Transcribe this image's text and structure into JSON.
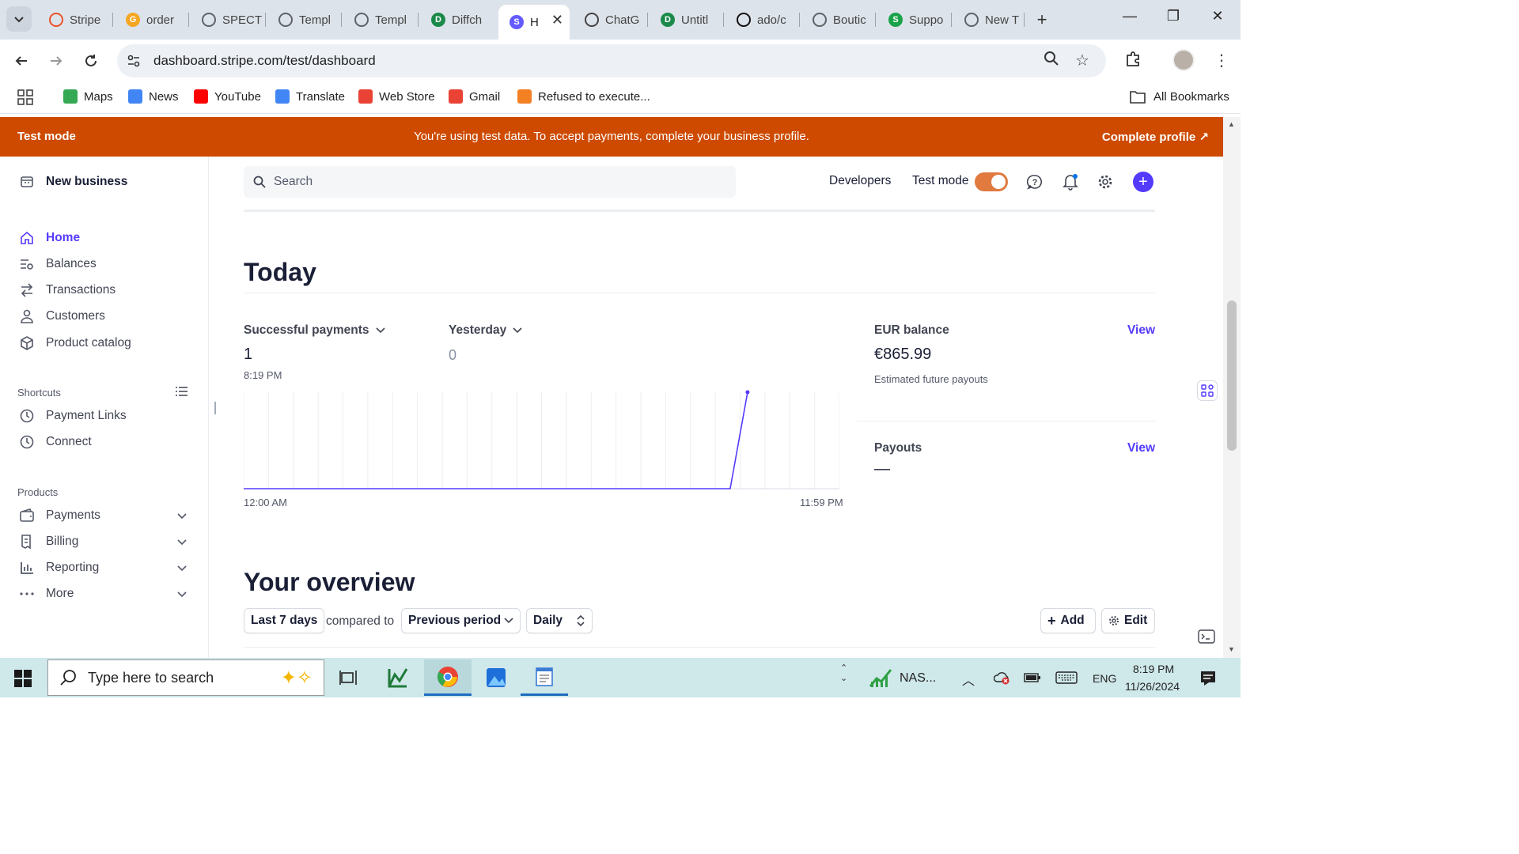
{
  "browser": {
    "tabs": [
      {
        "label": "Stripe",
        "color": "#e8532b",
        "letter": ""
      },
      {
        "label": "order",
        "color": "#f5a623",
        "letter": "G"
      },
      {
        "label": "SPECT",
        "color": "#5f6368",
        "letter": ""
      },
      {
        "label": "Templ",
        "color": "#5f6368",
        "letter": ""
      },
      {
        "label": "Templ",
        "color": "#5f6368",
        "letter": ""
      },
      {
        "label": "Diffch",
        "color": "#1a8a4a",
        "letter": "D"
      },
      {
        "label": "H",
        "color": "#635bff",
        "letter": "S"
      },
      {
        "label": "ChatG",
        "color": "#444444",
        "letter": ""
      },
      {
        "label": "Untitl",
        "color": "#1a8a4a",
        "letter": "D"
      },
      {
        "label": "ado/c",
        "color": "#111111",
        "letter": ""
      },
      {
        "label": "Boutic",
        "color": "#5f6368",
        "letter": ""
      },
      {
        "label": "Suppo",
        "color": "#1aa34a",
        "letter": "S"
      },
      {
        "label": "New T",
        "color": "#5f6368",
        "letter": ""
      }
    ],
    "url": "dashboard.stripe.com/test/dashboard",
    "bookmarks": [
      {
        "label": "Maps",
        "icon": "maps-pin-icon",
        "color": "#34a853"
      },
      {
        "label": "News",
        "icon": "news-icon",
        "color": "#4285f4"
      },
      {
        "label": "YouTube",
        "icon": "youtube-icon",
        "color": "#ff0000"
      },
      {
        "label": "Translate",
        "icon": "translate-icon",
        "color": "#4285f4"
      },
      {
        "label": "Web Store",
        "icon": "web-store-icon",
        "color": "#ea4335"
      },
      {
        "label": "Gmail",
        "icon": "gmail-icon",
        "color": "#ea4335"
      },
      {
        "label": "Refused to execute...",
        "icon": "stackoverflow-icon",
        "color": "#f48024"
      }
    ],
    "all_bookmarks": "All Bookmarks"
  },
  "banner": {
    "label": "Test mode",
    "message": "You're using test data. To accept payments, complete your business profile.",
    "cta": "Complete profile",
    "color": "#cd4a00"
  },
  "sidebar": {
    "account": "New business",
    "nav": [
      {
        "label": "Home",
        "icon": "home-icon",
        "active": true
      },
      {
        "label": "Balances",
        "icon": "balances-icon"
      },
      {
        "label": "Transactions",
        "icon": "transactions-icon"
      },
      {
        "label": "Customers",
        "icon": "customers-icon"
      },
      {
        "label": "Product catalog",
        "icon": "product-catalog-icon"
      }
    ],
    "shortcuts_title": "Shortcuts",
    "shortcuts": [
      {
        "label": "Payment Links",
        "icon": "clock-icon"
      },
      {
        "label": "Connect",
        "icon": "clock-icon"
      }
    ],
    "products_title": "Products",
    "products": [
      {
        "label": "Payments",
        "icon": "payments-icon"
      },
      {
        "label": "Billing",
        "icon": "billing-icon"
      },
      {
        "label": "Reporting",
        "icon": "reporting-icon"
      },
      {
        "label": "More",
        "icon": "more-icon"
      }
    ]
  },
  "topbar": {
    "search_placeholder": "Search",
    "developers": "Developers",
    "test_mode": "Test mode",
    "test_mode_on": true,
    "accent": "#533afd"
  },
  "today": {
    "title": "Today",
    "payments_label": "Successful payments",
    "payments_value": "1",
    "payments_time": "8:19 PM",
    "compare_label": "Yesterday",
    "compare_value": "0",
    "balance_label": "EUR balance",
    "balance_value": "€865.99",
    "balance_sub": "Estimated future payouts",
    "payouts_label": "Payouts",
    "payouts_value": "—",
    "view": "View",
    "x_start": "12:00 AM",
    "x_end": "11:59 PM"
  },
  "chart_data": {
    "type": "line",
    "x": [
      "12:00 AM",
      "11:59 PM"
    ],
    "xlabel": "",
    "ylabel": "",
    "series": [
      {
        "values": [
          {
            "x": 0,
            "y": 0
          },
          {
            "x": 19.6,
            "y": 0
          },
          {
            "x": 20.3,
            "y": 1
          }
        ]
      }
    ],
    "x_domain_hours": [
      0,
      24
    ],
    "ylim": [
      0,
      1
    ],
    "grid": true,
    "line_color": "#533afd"
  },
  "overview": {
    "title": "Your overview",
    "range": "Last 7 days",
    "compared_to": "compared to",
    "comparison": "Previous period",
    "interval": "Daily",
    "add": "Add",
    "edit": "Edit"
  },
  "taskbar": {
    "search_placeholder": "Type here to search",
    "stock": "NAS...",
    "lang": "ENG",
    "time": "8:19 PM",
    "date": "11/26/2024"
  }
}
